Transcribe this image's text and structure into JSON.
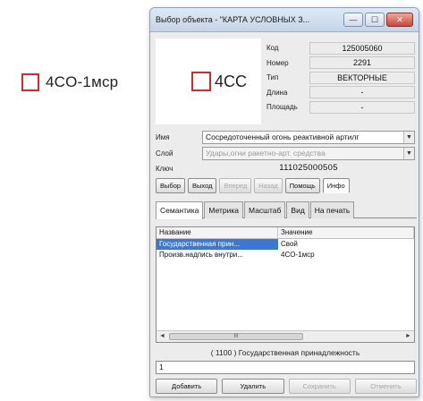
{
  "map_sign": {
    "label": "4CO-1мср"
  },
  "window": {
    "title": "Выбор объекта - \"КАРТА УСЛОВНЫХ З...",
    "controls": {
      "minimize": "—",
      "maximize": "☐",
      "close": "✕"
    }
  },
  "preview": {
    "label": "4CC"
  },
  "attributes": [
    {
      "label": "Код",
      "value": "125005060"
    },
    {
      "label": "Номер",
      "value": "2291"
    },
    {
      "label": "Тип",
      "value": "ВЕКТОРНЫЕ"
    },
    {
      "label": "Длина",
      "value": "-"
    },
    {
      "label": "Площадь",
      "value": "-"
    }
  ],
  "fields": {
    "name_label": "Имя",
    "name_value": "Сосредоточенный огонь реактивной артилг",
    "layer_label": "Слой",
    "layer_value": "Удары,огни ракетно-арт. средства",
    "key_label": "Ключ",
    "key_value": "111025000505"
  },
  "actions": [
    "Выбор",
    "Выход",
    "Вперед",
    "Назад",
    "Помощь",
    "Инфо"
  ],
  "tabs": [
    "Семантика",
    "Метрика",
    "Масштаб",
    "Вид",
    "На печать"
  ],
  "semantics": {
    "headers": [
      "Название",
      "Значение"
    ],
    "rows": [
      {
        "name": "Государственная прин...",
        "value": "Свой"
      },
      {
        "name": "Произв.надпись внутри...",
        "value": "4CO-1мср"
      }
    ],
    "scroll_thumb": "III"
  },
  "bottom": {
    "caption": "( 1100 ) Государственная принадлежность",
    "input_value": "1",
    "buttons": [
      "Добавить",
      "Удалить",
      "Сохранить",
      "Отменить"
    ]
  }
}
